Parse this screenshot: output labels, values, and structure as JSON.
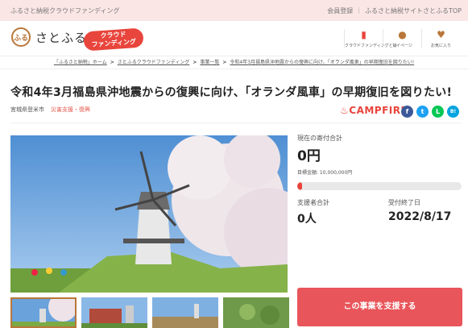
{
  "topbar": {
    "site_name": "ふるさと納税クラウドファンディング",
    "register": "会員登録",
    "separator": "|",
    "top_link": "ふるさと納税サイトさとふるTOP"
  },
  "header": {
    "logo_text": "さとふる",
    "logo_mark": "ふる",
    "badge": [
      "クラウド",
      "ファンディング"
    ],
    "nav": [
      {
        "label": "クラウドファンディングとは",
        "icon": "bookmark-icon",
        "glyph": "▮",
        "color": "#e8453c"
      },
      {
        "label": "マイページ",
        "icon": "user-icon",
        "glyph": "●",
        "color": "#b9773a"
      },
      {
        "label": "お気に入り",
        "icon": "heart-icon",
        "glyph": "♥",
        "color": "#b9773a"
      }
    ]
  },
  "breadcrumb": [
    "「ふるさと納税」ホーム",
    "さとふるクラウドファンディング",
    "事業一覧",
    "令和4年3月福島県沖地震からの復興に向け、「オランダ風車」の早期復旧を図りたい!"
  ],
  "breadcrumb_sep": ">",
  "project": {
    "title": "令和4年3月福島県沖地震からの復興に向け、「オランダ風車」の早期復旧を図りたい!",
    "location": "宮城県登米市",
    "category": "災害支援・復興",
    "partner": "♨CAMPFIRE"
  },
  "share": [
    {
      "icon": "facebook-icon",
      "glyph": "f",
      "color": "#3b5998"
    },
    {
      "icon": "twitter-icon",
      "glyph": "t",
      "color": "#1da1f2"
    },
    {
      "icon": "line-icon",
      "glyph": "L",
      "color": "#06c755"
    },
    {
      "icon": "hatena-icon",
      "glyph": "B!",
      "color": "#00a4de"
    }
  ],
  "stats": {
    "total_label": "現在の寄付合計",
    "total_value": "0円",
    "goal": "目標金額: 10,000,000円",
    "progress": 0.03,
    "supporters_label": "支援者合計",
    "supporters_value": "0人",
    "deadline_label": "受付終了日",
    "deadline_value": "2022/8/17"
  },
  "support_button": "この事業を支援する",
  "colors": {
    "accent": "#e8453c",
    "brand": "#b9773a",
    "topbar": "#fbe6e6"
  }
}
